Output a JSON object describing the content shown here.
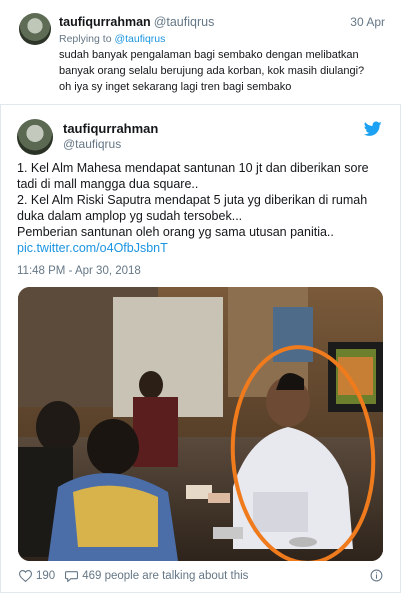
{
  "reply_tweet": {
    "name": "taufiqurrahman",
    "handle": "@taufiqrus",
    "date": "30 Apr",
    "replying_prefix": "Replying to",
    "replying_to": "@taufiqrus",
    "lines": [
      "sudah banyak pengalaman bagi sembako dengan melibatkan",
      "banyak orang selalu berujung ada korban, kok masih diulangi?",
      "oh iya sy inget sekarang lagi tren bagi sembako"
    ]
  },
  "main_tweet": {
    "name": "taufiqurrahman",
    "handle": "@taufiqrus",
    "lines": [
      "1. Kel Alm Mahesa mendapat santunan 10 jt dan diberikan sore",
      "tadi di mall mangga dua square..",
      "2. Kel Alm Riski Saputra mendapat 5 juta yg diberikan di rumah",
      "duka dalam amplop yg sudah tersobek...",
      "Pemberian santunan oleh orang yg sama utusan panitia.."
    ],
    "pic_link": "pic.twitter.com/o4OfbJsbnT",
    "timestamp": "11:48 PM - Apr 30, 2018",
    "like_count": "190",
    "talking_text": "469 people are talking about this"
  },
  "icons": {
    "brand": "twitter-bird-icon",
    "like": "heart-icon",
    "talk": "speech-bubble-icon",
    "info": "info-icon"
  },
  "colors": {
    "twitter_blue": "#1da1f2",
    "link": "#1b95e0",
    "secondary_text": "#657786",
    "highlight_circle": "#f07b1d"
  }
}
